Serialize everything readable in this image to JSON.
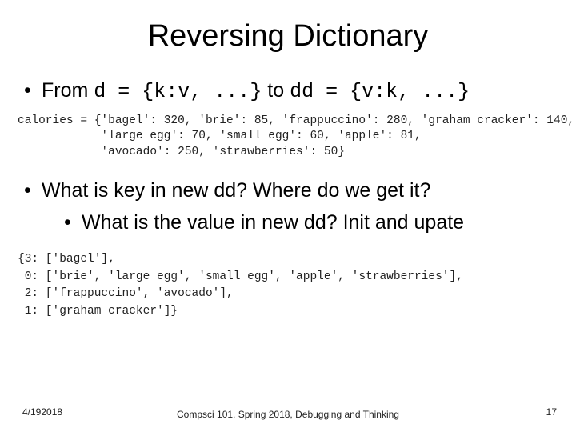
{
  "title": "Reversing Dictionary",
  "bullets": {
    "b1_prefix": "From ",
    "b1_code1": "d = {k:v, ...}",
    "b1_mid": " to ",
    "b1_code2": "dd = {v:k, ...}",
    "b2": "What is key in new dd? Where do we get it?",
    "b2a": "What is the value in new dd? Init and upate"
  },
  "code1": "calories = {'bagel': 320, 'brie': 85, 'frappuccino': 280, 'graham cracker': 140,\n            'large egg': 70, 'small egg': 60, 'apple': 81,\n            'avocado': 250, 'strawberries': 50}",
  "code2": "{3: ['bagel'],\n 0: ['brie', 'large egg', 'small egg', 'apple', 'strawberries'],\n 2: ['frappuccino', 'avocado'],\n 1: ['graham cracker']}",
  "footer": {
    "date": "4/192018",
    "center": "Compsci 101, Spring 2018, Debugging\nand Thinking",
    "page": "17"
  }
}
